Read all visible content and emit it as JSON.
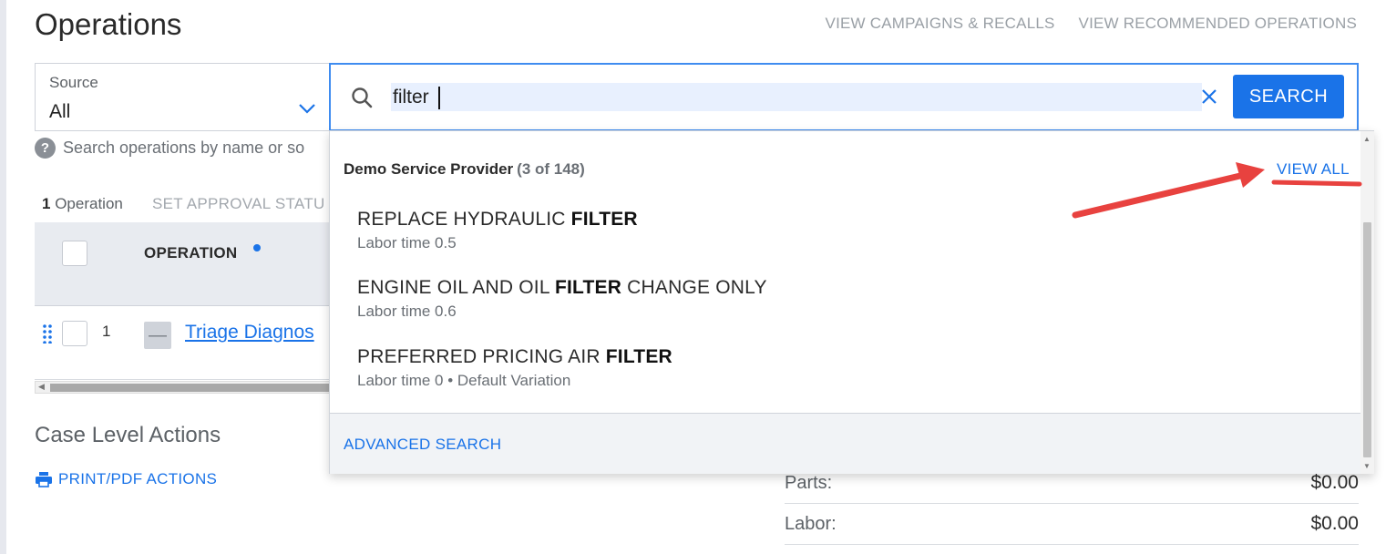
{
  "header": {
    "title": "Operations",
    "links": [
      "VIEW CAMPAIGNS & RECALLS",
      "VIEW RECOMMENDED OPERATIONS"
    ]
  },
  "source": {
    "label": "Source",
    "value": "All"
  },
  "search": {
    "value": "filter",
    "button_label": "SEARCH"
  },
  "help": {
    "text": "Search operations by name or so"
  },
  "operations": {
    "count_number": "1",
    "count_label": " Operation",
    "approval_link": "SET APPROVAL STATU",
    "column_operation": "OPERATION",
    "rows": [
      {
        "number": "1",
        "link": "Triage Diagnos"
      }
    ]
  },
  "case_actions": {
    "title": "Case Level Actions",
    "print_label": "PRINT/PDF ACTIONS"
  },
  "totals": [
    {
      "label": "Parts:",
      "value": "$0.00"
    },
    {
      "label": "Labor:",
      "value": "$0.00"
    }
  ],
  "dropdown": {
    "provider": "Demo Service Provider",
    "count": "(3 of 148)",
    "view_all": "VIEW ALL",
    "results": [
      {
        "title_pre": "REPLACE HYDRAULIC ",
        "title_match": "FILTER",
        "title_post": "",
        "sub": "Labor time 0.5"
      },
      {
        "title_pre": "ENGINE OIL AND OIL ",
        "title_match": "FILTER",
        "title_post": " CHANGE ONLY",
        "sub": "Labor time 0.6"
      },
      {
        "title_pre": "PREFERRED PRICING AIR ",
        "title_match": "FILTER",
        "title_post": "",
        "sub": "Labor time 0 • Default Variation"
      }
    ],
    "advanced_search": "ADVANCED SEARCH"
  },
  "colors": {
    "accent": "#1a73e8",
    "annotation": "#e8423f"
  }
}
